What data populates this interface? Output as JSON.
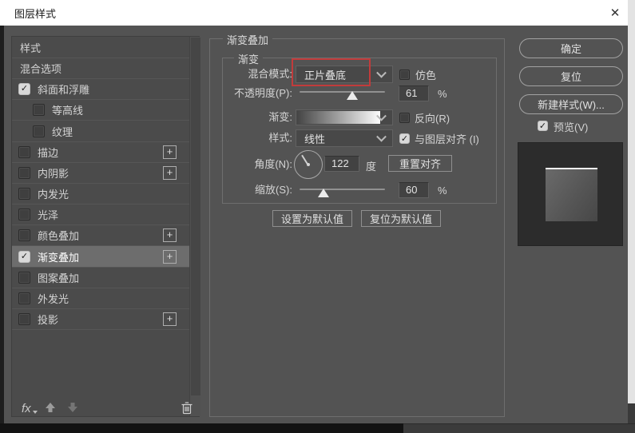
{
  "window": {
    "title": "图层样式"
  },
  "icons": {
    "close": "✕",
    "check": "✓",
    "plus": "+",
    "fx": "fx"
  },
  "colors": {
    "annotation_red": "#c23b3b",
    "dialog_bg": "#535353",
    "sidebar_bg": "#4b4b4b",
    "selected_row": "#6d6d6d"
  },
  "sidebar": {
    "items": [
      {
        "label": "样式",
        "checkbox": false,
        "checked": false,
        "indent": false,
        "plus": false,
        "selected": false
      },
      {
        "label": "混合选项",
        "checkbox": false,
        "checked": false,
        "indent": false,
        "plus": false,
        "selected": false
      },
      {
        "label": "斜面和浮雕",
        "checkbox": true,
        "checked": true,
        "indent": false,
        "plus": false,
        "selected": false
      },
      {
        "label": "等高线",
        "checkbox": true,
        "checked": false,
        "indent": true,
        "plus": false,
        "selected": false
      },
      {
        "label": "纹理",
        "checkbox": true,
        "checked": false,
        "indent": true,
        "plus": false,
        "selected": false
      },
      {
        "label": "描边",
        "checkbox": true,
        "checked": false,
        "indent": false,
        "plus": true,
        "selected": false
      },
      {
        "label": "内阴影",
        "checkbox": true,
        "checked": false,
        "indent": false,
        "plus": true,
        "selected": false
      },
      {
        "label": "内发光",
        "checkbox": true,
        "checked": false,
        "indent": false,
        "plus": false,
        "selected": false
      },
      {
        "label": "光泽",
        "checkbox": true,
        "checked": false,
        "indent": false,
        "plus": false,
        "selected": false
      },
      {
        "label": "颜色叠加",
        "checkbox": true,
        "checked": false,
        "indent": false,
        "plus": true,
        "selected": false
      },
      {
        "label": "渐变叠加",
        "checkbox": true,
        "checked": true,
        "indent": false,
        "plus": true,
        "selected": true
      },
      {
        "label": "图案叠加",
        "checkbox": true,
        "checked": false,
        "indent": false,
        "plus": false,
        "selected": false
      },
      {
        "label": "外发光",
        "checkbox": true,
        "checked": false,
        "indent": false,
        "plus": false,
        "selected": false
      },
      {
        "label": "投影",
        "checkbox": true,
        "checked": false,
        "indent": false,
        "plus": true,
        "selected": false
      }
    ],
    "footer": {
      "fx_label": "fx"
    }
  },
  "panel": {
    "group_title": "渐变叠加",
    "subgroup_title": "渐变",
    "blend_mode": {
      "label": "混合模式:",
      "value": "正片叠底",
      "dither_label": "仿色",
      "dither_checked": false
    },
    "opacity": {
      "label": "不透明度(P):",
      "value": "61",
      "unit": "%",
      "percent": 61.5
    },
    "gradient": {
      "label": "渐变:",
      "reverse_label": "反向(R)",
      "reverse_checked": false
    },
    "style": {
      "label": "样式:",
      "value": "线性",
      "align_label": "与图层对齐 (I)",
      "align_checked": true
    },
    "angle": {
      "label": "角度(N):",
      "value": "122",
      "unit": "度",
      "reset_button": "重置对齐",
      "degrees": 122
    },
    "scale": {
      "label": "缩放(S):",
      "value": "60",
      "unit": "%",
      "percent": 28
    },
    "default_buttons": {
      "set_default": "设置为默认值",
      "reset_default": "复位为默认值"
    }
  },
  "actions": {
    "ok": "确定",
    "reset": "复位",
    "new_style": "新建样式(W)...",
    "preview_label": "预览(V)",
    "preview_checked": true
  }
}
